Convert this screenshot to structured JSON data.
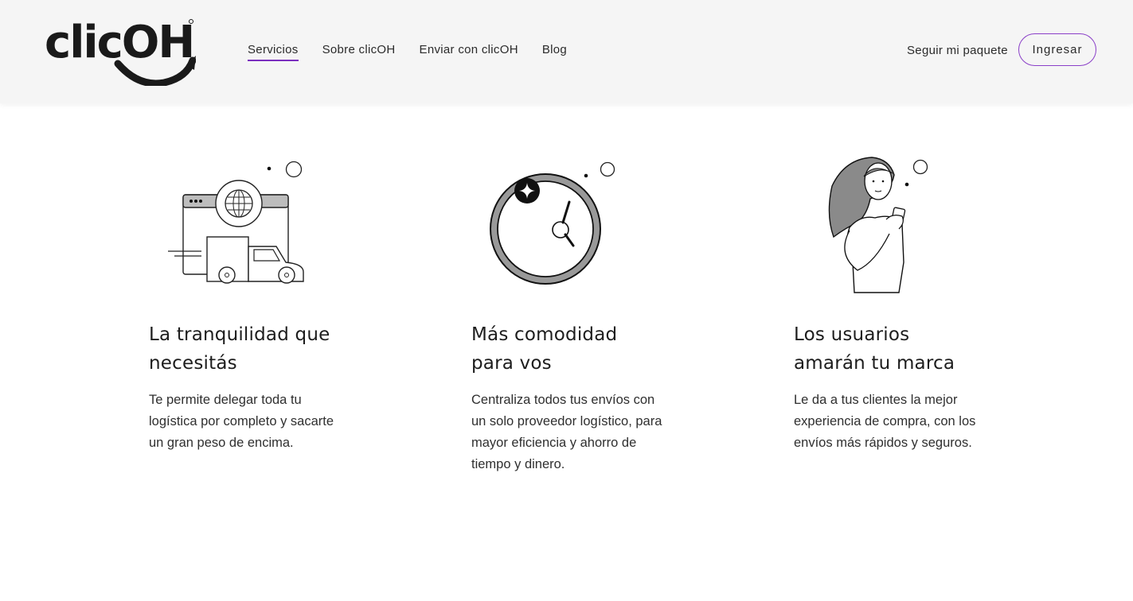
{
  "header": {
    "logo_text": "clicOH",
    "nav": [
      {
        "label": "Servicios",
        "active": true
      },
      {
        "label": "Sobre clicOH",
        "active": false
      },
      {
        "label": "Enviar con clicOH",
        "active": false
      },
      {
        "label": "Blog",
        "active": false
      }
    ],
    "track_label": "Seguir mi paquete",
    "login_label": "Ingresar"
  },
  "colors": {
    "accent": "#7b2fbf",
    "header_bg": "#f5f5f5",
    "text": "#222222"
  },
  "features": [
    {
      "icon": "delivery-truck-globe-illustration",
      "title_line1": "La tranquilidad que",
      "title_line2": "necesitás",
      "desc": "Te permite delegar toda tu logística por completo y sacarte un gran peso de encima."
    },
    {
      "icon": "clock-illustration",
      "title_line1": "Más comodidad",
      "title_line2": "para vos",
      "desc": "Centraliza todos tus envíos con un solo proveedor logístico, para mayor eficiencia y ahorro de tiempo y dinero."
    },
    {
      "icon": "woman-with-phone-illustration",
      "title_line1": "Los usuarios",
      "title_line2": "amarán tu marca",
      "desc": "Le da a tus clientes la mejor experiencia de compra, con los envíos más rápidos y seguros."
    }
  ]
}
